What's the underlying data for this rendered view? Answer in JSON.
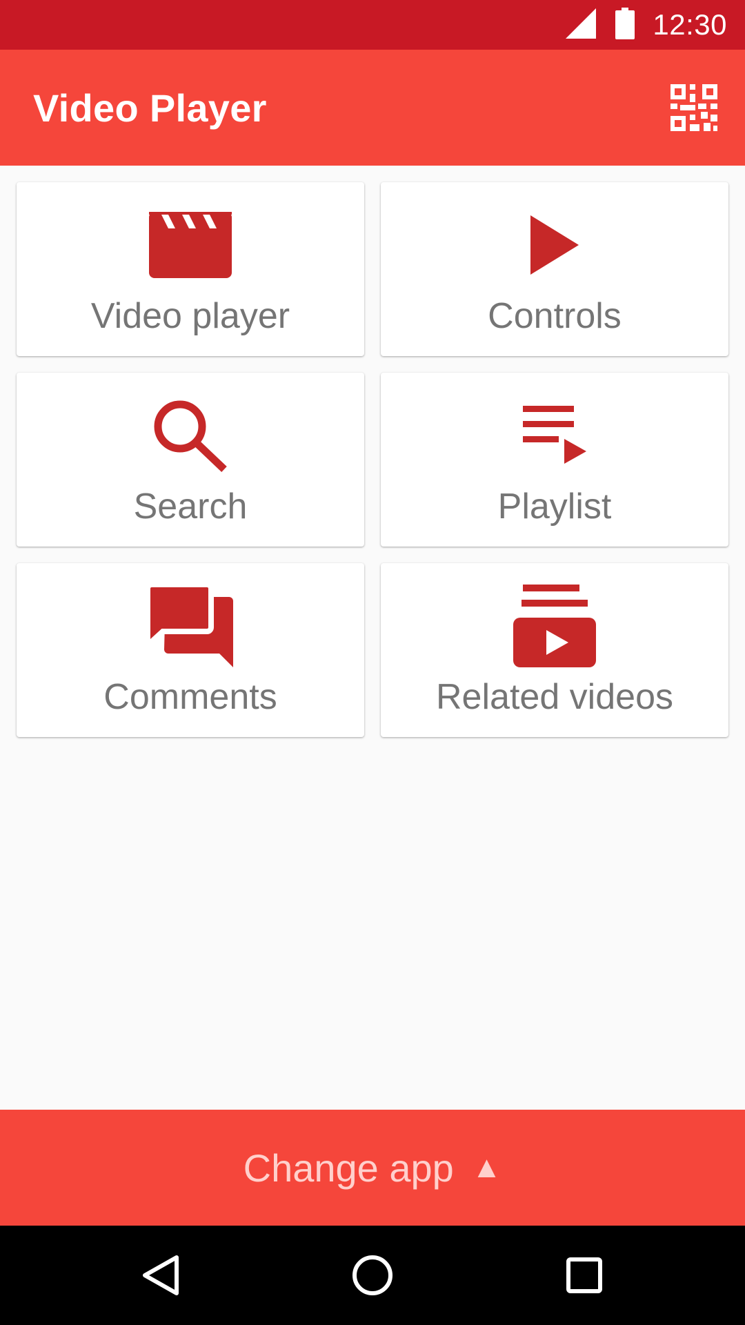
{
  "status_bar": {
    "time": "12:30",
    "icons": [
      "signal-icon",
      "battery-icon"
    ]
  },
  "app_bar": {
    "title": "Video Player",
    "action_icon": "qr-code-icon"
  },
  "cards": [
    {
      "label": "Video player",
      "icon": "clapperboard-icon"
    },
    {
      "label": "Controls",
      "icon": "play-icon"
    },
    {
      "label": "Search",
      "icon": "search-icon"
    },
    {
      "label": "Playlist",
      "icon": "playlist-play-icon"
    },
    {
      "label": "Comments",
      "icon": "chat-bubbles-icon"
    },
    {
      "label": "Related videos",
      "icon": "video-library-icon"
    }
  ],
  "footer": {
    "change_app_label": "Change app",
    "arrow": "▲"
  },
  "navigation": [
    "back-icon",
    "home-icon",
    "recents-icon"
  ],
  "colors": {
    "status_bar": "#c81925",
    "primary": "#f5463b",
    "icon": "#c62828",
    "label": "#757575",
    "background": "#fafafa"
  }
}
